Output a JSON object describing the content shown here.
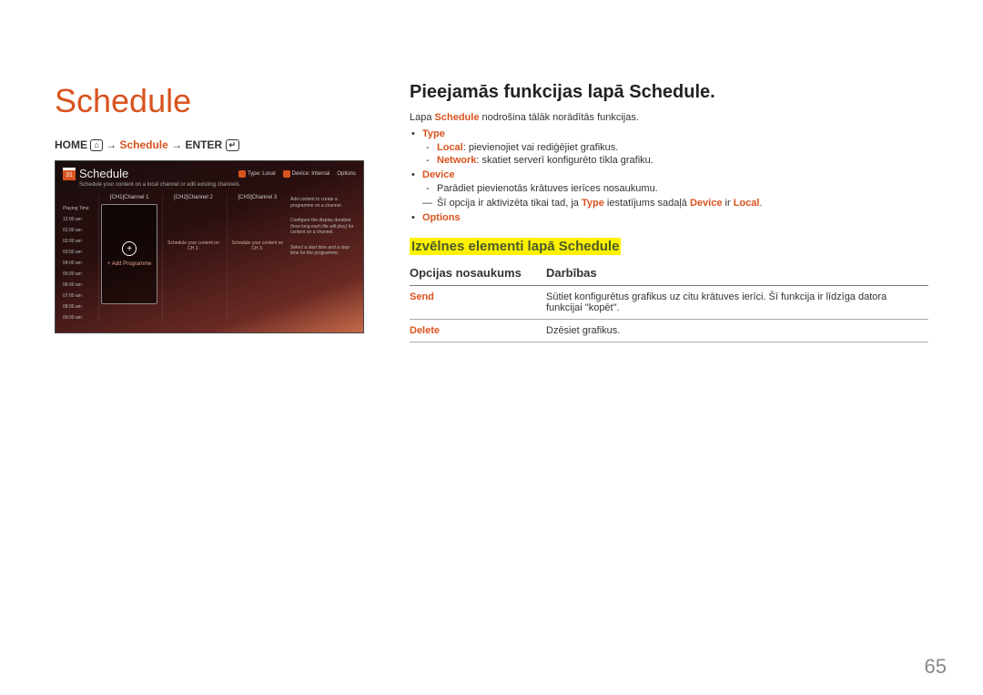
{
  "left": {
    "title": "Schedule",
    "nav_home": "HOME",
    "nav_schedule": "Schedule",
    "nav_enter": "ENTER",
    "arrow": "→"
  },
  "tv": {
    "cal_day": "31",
    "title": "Schedule",
    "chip_type": "Type: Local",
    "chip_device": "Device: Internal",
    "chip_options": "Options",
    "subtitle": "Schedule your content on a local channel or edit existing channels.",
    "playtime_head": "Playing Time",
    "times": [
      "12:00 am",
      "01:00 am",
      "02:00 am",
      "03:00 am",
      "04:00 am",
      "05:00 am",
      "06:00 am",
      "07:00 am",
      "08:00 am",
      "09:00 am"
    ],
    "col1": "[CH1]Channel 1",
    "col2": "[CH2]Channel 2",
    "col3": "[CH3]Channel 3",
    "add_prog": "+ Add Programme",
    "note2": "Schedule your content on CH 2.",
    "note3": "Schedule your content on CH 3.",
    "info1": "Add content to create a programme on a channel.",
    "info2": "Configure the display duration (how long each file will play) for content on a channel.",
    "info3": "Select a start time and a stop time for the programme."
  },
  "right": {
    "h1": "Pieejamās funkcijas lapā Schedule.",
    "intro_pre": "Lapa ",
    "intro_bold": "Schedule",
    "intro_post": " nodrošina tālāk norādītās funkcijas.",
    "type_label": "Type",
    "type_local_key": "Local",
    "type_local_txt": ": pievienojiet vai rediģējiet grafikus.",
    "type_network_key": "Network",
    "type_network_txt": ": skatiet serverī konfigurēto tīkla grafiku.",
    "device_label": "Device",
    "device_txt": "Parādiet pievienotās krātuves ierīces nosaukumu.",
    "device_note_pre": "Šī opcija ir aktivizēta tikai tad, ja ",
    "device_note_type": "Type",
    "device_note_mid": " iestatījums sadaļā ",
    "device_note_device": "Device",
    "device_note_sep": " ir ",
    "device_note_local": "Local",
    "device_note_end": ".",
    "options_label": "Options",
    "sub_h": "Izvēlnes elementi lapā Schedule",
    "th_name": "Opcijas nosaukums",
    "th_action": "Darbības",
    "row_send": "Send",
    "row_send_txt": "Sūtiet konfigurētus grafikus uz citu krātuves ierīci. Šī funkcija ir līdzīga datora funkcijai \"kopēt\".",
    "row_delete": "Delete",
    "row_delete_txt": "Dzēsiet grafikus."
  },
  "page_number": "65"
}
